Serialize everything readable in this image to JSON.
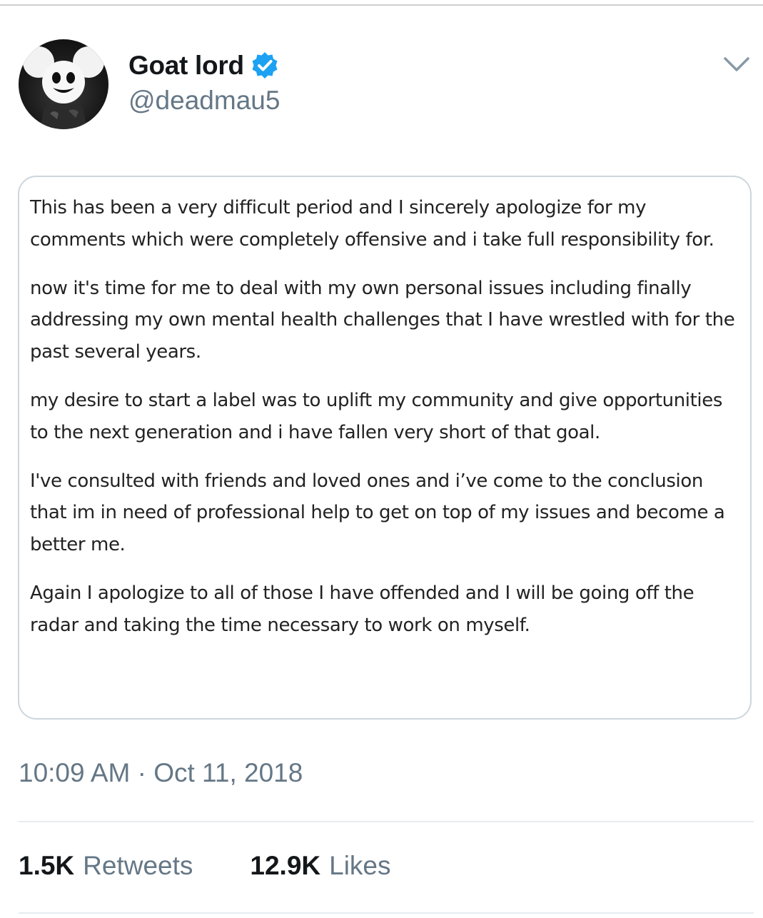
{
  "tweet": {
    "author": {
      "display_name": "Goat lord",
      "handle": "@deadmau5",
      "verified": true,
      "avatar_icon": "deadmau5-mouse-head-avatar"
    },
    "menu_icon": "chevron-down-icon",
    "attachment_paragraphs": [
      "This has been a very difficult period and I sincerely apologize for my comments which were completely offensive and i take full responsibility for.",
      "now it's time for me to deal with my own personal issues including finally addressing my own mental health challenges that I have wrestled with for the past several years.",
      "my desire to start a label was to uplift my community and give opportunities to the next generation and i have fallen very short of that goal.",
      "I've consulted with friends and loved ones and i’ve come to the conclusion that im in need of professional help to get on top of my issues and become a better me.",
      "Again I apologize to all of those I have offended and I will be going off the radar and taking the time necessary to work on myself."
    ],
    "timestamp": "10:09 AM · Oct 11, 2018",
    "stats": {
      "retweets_count": "1.5K",
      "retweets_label": "Retweets",
      "likes_count": "12.9K",
      "likes_label": "Likes"
    }
  },
  "colors": {
    "verified_blue": "#1da1f2",
    "secondary_text": "#657786",
    "primary_text": "#14171a",
    "border": "#ccd6dd"
  }
}
